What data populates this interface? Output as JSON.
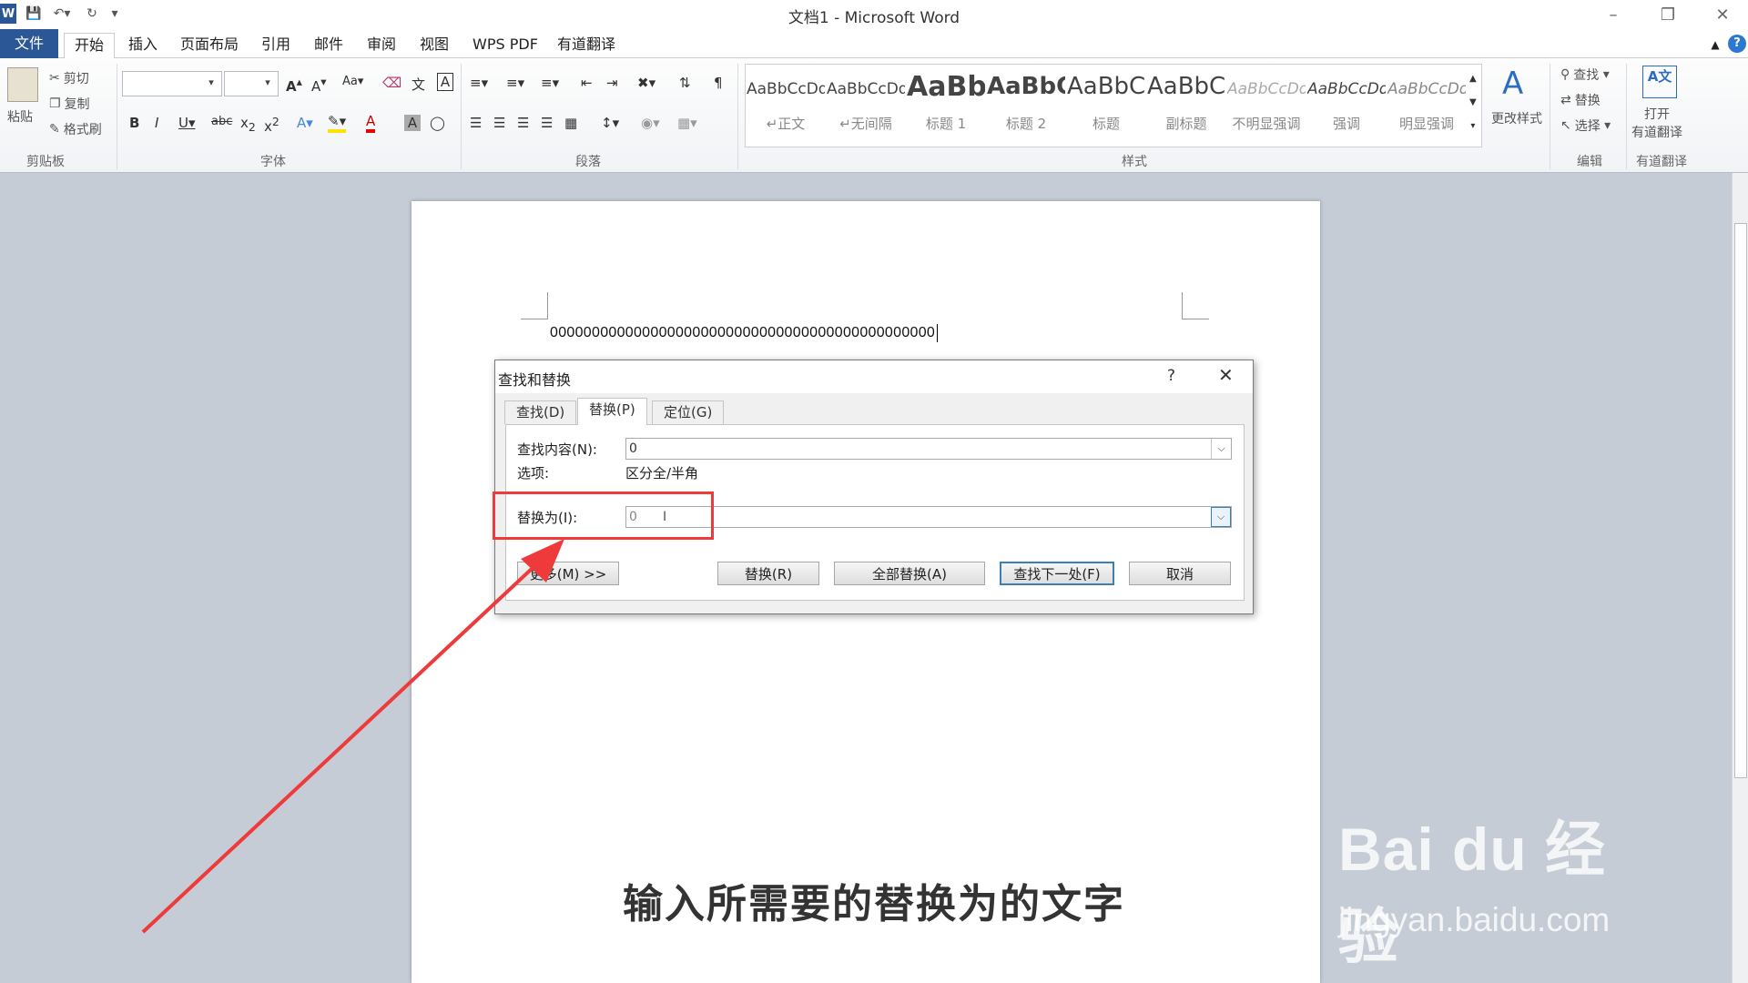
{
  "window": {
    "title": "文档1 - Microsoft Word",
    "app_icon": "W"
  },
  "menu_tabs": [
    {
      "label": "文件"
    },
    {
      "label": "开始"
    },
    {
      "label": "插入"
    },
    {
      "label": "页面布局"
    },
    {
      "label": "引用"
    },
    {
      "label": "邮件"
    },
    {
      "label": "审阅"
    },
    {
      "label": "视图"
    },
    {
      "label": "WPS PDF"
    },
    {
      "label": "有道翻译"
    }
  ],
  "ribbon": {
    "clipboard": {
      "paste": "粘贴",
      "cut": "剪切",
      "copy": "复制",
      "format_painter": "格式刷",
      "label": "剪贴板"
    },
    "font": {
      "label": "字体"
    },
    "paragraph": {
      "label": "段落"
    },
    "styles": {
      "label": "样式",
      "tiles": [
        {
          "sample": "AaBbCcDd",
          "name": "↵正文"
        },
        {
          "sample": "AaBbCcDd",
          "name": "↵无间隔"
        },
        {
          "sample": "AaBb",
          "name": "标题 1"
        },
        {
          "sample": "AaBbC",
          "name": "标题 2"
        },
        {
          "sample": "AaBbC",
          "name": "标题"
        },
        {
          "sample": "AaBbC",
          "name": "副标题"
        },
        {
          "sample": "AaBbCcDd",
          "name": "不明显强调"
        },
        {
          "sample": "AaBbCcDd",
          "name": "强调"
        },
        {
          "sample": "AaBbCcDd",
          "name": "明显强调"
        }
      ],
      "change_styles": "更改样式"
    },
    "editing": {
      "find": "查找",
      "replace": "替换",
      "select": "选择",
      "label": "编辑"
    },
    "youdao": {
      "open_line1": "打开",
      "open_line2": "有道翻译",
      "label": "有道翻译"
    }
  },
  "document": {
    "text": "0000000000000000000000000000000000000000000000"
  },
  "dialog": {
    "title": "查找和替换",
    "help": "?",
    "close": "✕",
    "tabs": [
      {
        "label": "查找(D)"
      },
      {
        "label": "替换(P)"
      },
      {
        "label": "定位(G)"
      }
    ],
    "find_label": "查找内容(N):",
    "find_value": "0",
    "options_label": "选项:",
    "options_value": "区分全/半角",
    "replace_label": "替换为(I):",
    "replace_value": "0",
    "buttons": {
      "more": "更多(M) >>",
      "replace": "替换(R)",
      "replace_all": "全部替换(A)",
      "find_next": "查找下一处(F)",
      "cancel": "取消"
    }
  },
  "annotation": {
    "caption": "输入所需要的替换为的文字",
    "highlight_color": "#ee3a3a"
  },
  "watermark": {
    "brand": "Bai du 经验",
    "url": "jingyan.baidu.com"
  }
}
